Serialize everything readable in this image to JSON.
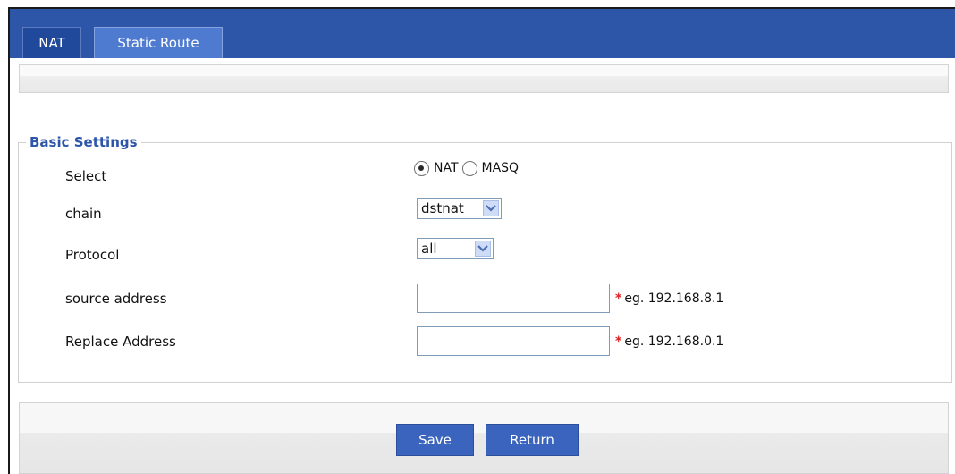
{
  "tabs": {
    "nat": "NAT",
    "static_route": "Static Route"
  },
  "basic_settings": {
    "legend": "Basic Settings",
    "select": {
      "label": "Select",
      "options": [
        "NAT",
        "MASQ"
      ],
      "selected": "NAT",
      "option_nat": "NAT",
      "option_masq": "MASQ"
    },
    "chain": {
      "label": "chain",
      "value": "dstnat"
    },
    "protocol": {
      "label": "Protocol",
      "value": "all"
    },
    "source_address": {
      "label": "source address",
      "value": "",
      "required_mark": "*",
      "hint": "eg. 192.168.8.1"
    },
    "replace_address": {
      "label": "Replace Address",
      "value": "",
      "required_mark": "*",
      "hint": "eg. 192.168.0.1"
    }
  },
  "buttons": {
    "save": "Save",
    "return": "Return"
  },
  "colors": {
    "tab_bar": "#2d55a8",
    "legend_text": "#2d55a8",
    "button": "#3a64bd",
    "required_star": "#e02020"
  }
}
